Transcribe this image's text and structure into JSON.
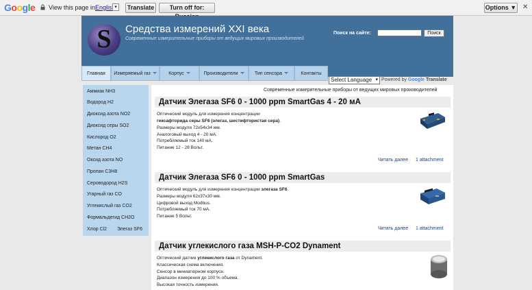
{
  "translate_bar": {
    "logo": "Google",
    "view_label": "View this page in:",
    "language": "English",
    "dropdown_glyph": "▾",
    "translate_button": "Translate",
    "turn_off_button": "Turn off for: Russian",
    "options_button": "Options ▼",
    "close_glyph": "✕"
  },
  "header": {
    "logo_letter": "S",
    "title": "Средства измерений XXI века",
    "subtitle": "Современные измерительные приборы от ведущих мировых производителей",
    "search_label": "Поиск на сайте:",
    "search_value": "",
    "search_button": "Поиск",
    "colors": {
      "header_bg": "#41709a",
      "nav_bg": "#b5d2ec",
      "sidebar_bg": "#b9d6ef"
    }
  },
  "nav": {
    "items": [
      {
        "label": "Главная",
        "has_caret": false
      },
      {
        "label": "Измеряемый газ",
        "has_caret": true
      },
      {
        "label": "Корпус",
        "has_caret": true
      },
      {
        "label": "Производители",
        "has_caret": true
      },
      {
        "label": "Тип сенсора",
        "has_caret": true
      },
      {
        "label": "Контакты",
        "has_caret": false
      }
    ]
  },
  "language_widget": {
    "selected": "Select Language",
    "powered_by": "Powered by",
    "google": "Google",
    "translate": "Translate"
  },
  "sidebar": {
    "items": [
      "Аммиак NH3",
      "Водород H2",
      "Диоксид азота NO2",
      "Диоксид серы SO2",
      "Кислород O2",
      "Метан CH4",
      "Оксид азота NO",
      "Пропан C3H8",
      "Сероводород H2S",
      "Угарный газ CO",
      "Углекислый газ CO2",
      "Формальдегид CH2O",
      "Хлор Cl2",
      "Элегаз SF6"
    ]
  },
  "main": {
    "tagline": "Современные измерительные приборы от ведущих мировых производителей",
    "articles": [
      {
        "title": "Датчик Элегаза SF6 0 - 1000 ppm SmartGas 4 - 20 мА",
        "lines": [
          [
            "Оптический модуль для измерения концентрации",
            "",
            ""
          ],
          [
            "",
            "гексафторида серы SF6 (элегаз, шестифтористая сера)",
            "."
          ],
          [
            "Размеры модуля 72х54х34 мм.",
            "",
            ""
          ],
          [
            "Аналоговый выход 4 - 20 мА.",
            "",
            ""
          ],
          [
            "Потребляемый ток 140 мА.",
            "",
            ""
          ],
          [
            "Питание 12 - 28 Вольт.",
            "",
            ""
          ]
        ],
        "read_more": "Читать далее",
        "attachment": "1 attachment",
        "image_icon": "circuit-module-icon"
      },
      {
        "title": "Датчик Элегаза SF6 0 - 1000 ppm SmartGas",
        "lines": [
          [
            "Оптический модуль для измерения концентрации ",
            "элегаза SF6",
            "."
          ],
          [
            "Размеры модуля 62х37х30 мм.",
            "",
            ""
          ],
          [
            "Цифровой выход Modbus.",
            "",
            ""
          ],
          [
            "Потребляемый ток 70 мА.",
            "",
            ""
          ],
          [
            "Питание 5 Вольт.",
            "",
            ""
          ]
        ],
        "read_more": "Читать далее",
        "attachment": "1 attachment",
        "image_icon": "sensor-module-icon"
      },
      {
        "title": "Датчик углекислого газа MSH-P-CO2 Dynament",
        "lines": [
          [
            "Оптический датчик ",
            "углекислого газа",
            " от Dynament."
          ],
          [
            "Классическая схема включения.",
            "",
            ""
          ],
          [
            "Сенсор в миниатюрном корпусе.",
            "",
            ""
          ],
          [
            "Диапазон измерения до 100 % объема.",
            "",
            ""
          ],
          [
            "Высокая точность измерения.",
            "",
            ""
          ]
        ],
        "image_icon": "cylindrical-sensor-icon"
      }
    ]
  }
}
